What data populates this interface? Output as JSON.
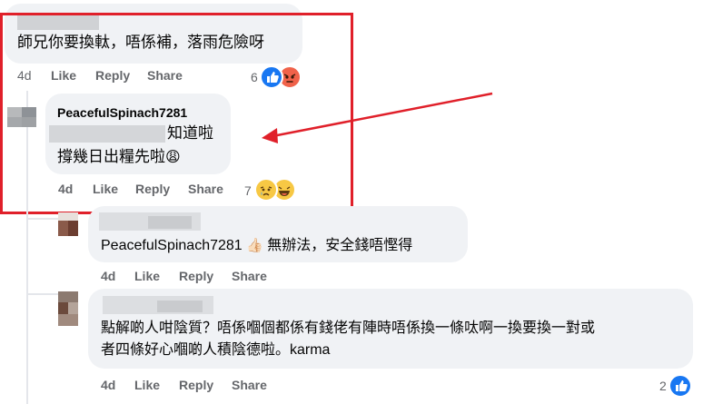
{
  "comment_top": {
    "text": "師兄你要換軚，唔係補，落雨危險呀",
    "time": "4d",
    "like": "Like",
    "reply": "Reply",
    "share": "Share",
    "reaction_count": "6",
    "reactions": [
      "like-icon",
      "angry-icon"
    ]
  },
  "reply_1": {
    "author": "PeacefulSpinach7281",
    "line1": "知道啦",
    "line2": "撐幾日出糧先啦",
    "emoji": "😩",
    "time": "4d",
    "like": "Like",
    "reply": "Reply",
    "share": "Share",
    "reaction_count": "7",
    "reactions": [
      "sad-icon",
      "haha-icon"
    ]
  },
  "reply_2": {
    "text_prefix": "PeacefulSpinach7281",
    "emoji": "👍🏻",
    "text": "無辦法，安全錢唔慳得",
    "time": "4d",
    "like": "Like",
    "reply": "Reply",
    "share": "Share"
  },
  "reply_3": {
    "line1": "點解啲人咁陰質？唔係嗰個都係有錢佬有陣時唔係換一條呔啊一換要換一對或",
    "line2": "者四條好心嗰啲人積陰德啦。karma",
    "time": "4d",
    "like": "Like",
    "reply": "Reply",
    "share": "Share",
    "reaction_count": "2",
    "reactions": [
      "like-icon"
    ]
  },
  "colors": {
    "highlight_box": "#e0202a",
    "arrow": "#e0202a",
    "bubble": "#f0f2f5",
    "meta_text": "#65676b",
    "like_blue": "#1877f2"
  }
}
